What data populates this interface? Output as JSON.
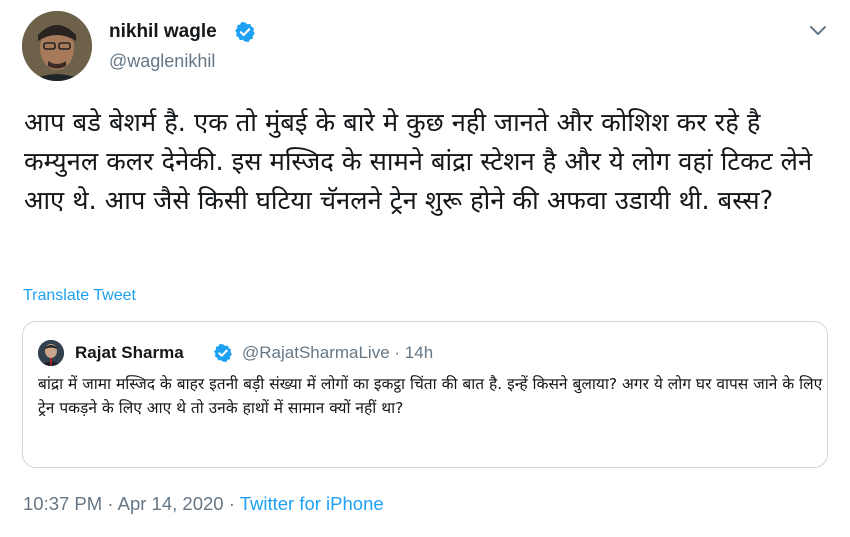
{
  "author": {
    "name": "nikhil wagle",
    "handle": "@waglenikhil",
    "verified": true
  },
  "tweet_text": "आप बडे बेशर्म है. एक तो मुंबई के बारे मे कुछ नही जानते और कोशिश कर रहे है कम्युनल कलर देनेकी. इस मस्जिद के सामने बांद्रा स्टेशन है और ये लोग वहां टिकट लेने आए थे. आप जैसे किसी घटिया चॅनलने ट्रेन शुरू होने की अफवा उडायी थी. बस्स?",
  "translate_label": "Translate Tweet",
  "quoted_tweet": {
    "name": "Rajat Sharma",
    "verified": true,
    "handle": "@RajatSharmaLive",
    "separator": "·",
    "time_ago": "14h",
    "text": "बांद्रा में जामा मस्जिद के बाहर इतनी बड़ी संख्या में  लोगों का इकट्ठा चिंता की बात है. इन्हें किसने बुलाया? अगर ये लोग घर वापस जाने के लिए ट्रेन पकड़ने के लिए आए थे तो उनके हाथों में सामान क्यों नहीं था?"
  },
  "meta": {
    "time": "10:37 PM",
    "separator": "·",
    "date": "Apr 14, 2020",
    "source": "Twitter for iPhone"
  },
  "colors": {
    "link_blue": "#1da1f2",
    "muted_gray": "#657786",
    "border": "#ccd6dd",
    "verified_badge": "#1da1f2"
  },
  "icons": {
    "verified": "verified-badge-icon",
    "more": "chevron-down-icon"
  }
}
